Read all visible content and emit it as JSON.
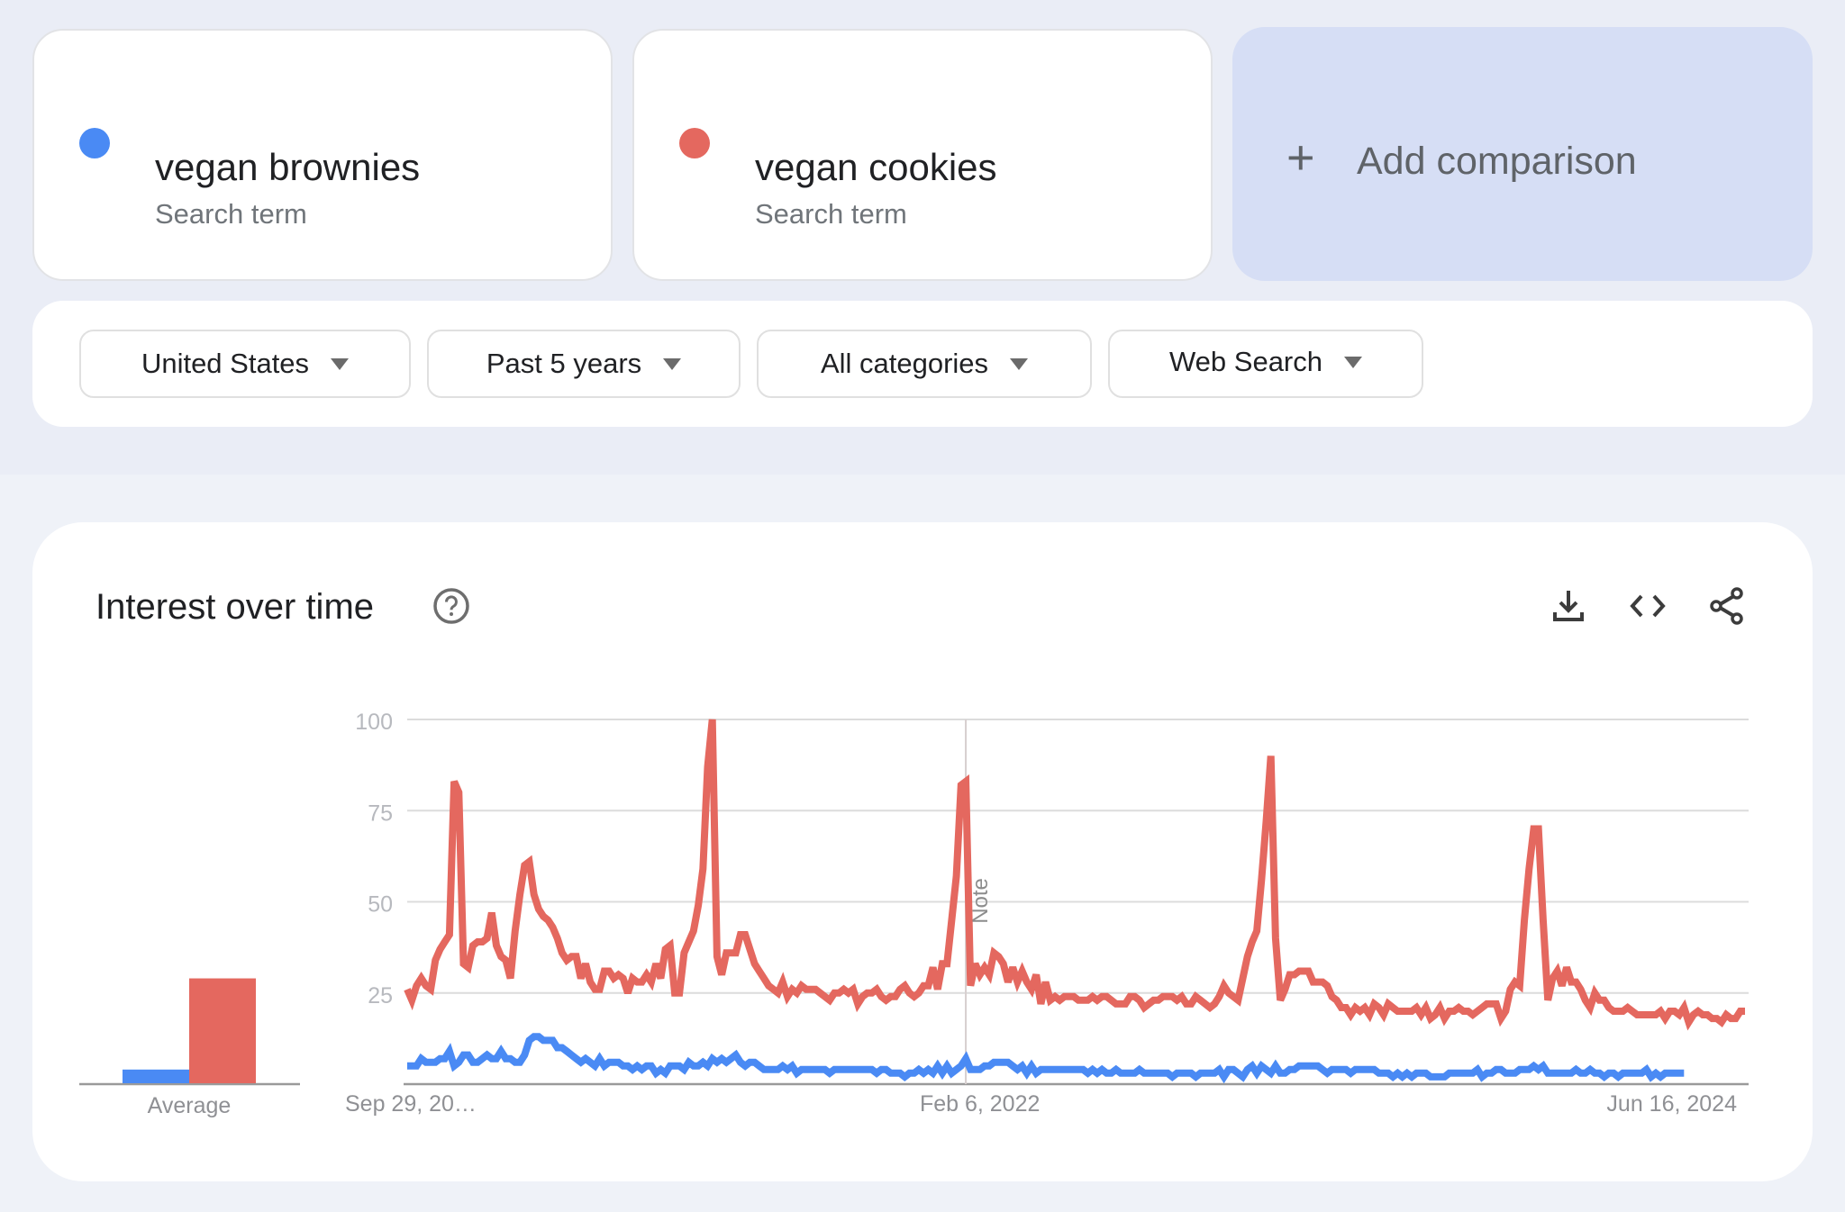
{
  "terms": [
    {
      "name": "vegan brownies",
      "subtitle": "Search term",
      "color": "#4a8af4"
    },
    {
      "name": "vegan cookies",
      "subtitle": "Search term",
      "color": "#e4685f"
    }
  ],
  "add_comparison": {
    "icon": "plus-icon",
    "label": "Add comparison"
  },
  "filters": [
    {
      "label": "United States"
    },
    {
      "label": "Past 5 years"
    },
    {
      "label": "All categories"
    },
    {
      "label": "Web Search"
    }
  ],
  "panel": {
    "title": "Interest over time",
    "help_icon": "help-circle-icon",
    "actions": [
      "download-icon",
      "embed-code-icon",
      "share-icon"
    ]
  },
  "chart_data": {
    "type": "line",
    "title": "Interest over time",
    "xlabel": "",
    "ylabel": "",
    "ylim": [
      0,
      100
    ],
    "yticks": [
      25,
      50,
      75,
      100
    ],
    "grid": true,
    "legend": "none",
    "x_tick_labels": [
      "Sep 29, 20…",
      "Feb 6, 2022",
      "Jun 16, 2024"
    ],
    "x_tick_indices": [
      0,
      122,
      246
    ],
    "annotation": {
      "label": "Note",
      "index": 119
    },
    "average_bar": {
      "label": "Average",
      "values": [
        {
          "name": "vegan brownies",
          "value": 4
        },
        {
          "name": "vegan cookies",
          "value": 29
        }
      ]
    },
    "series": [
      {
        "name": "vegan cookies",
        "color": "#e4685f",
        "values": [
          26,
          23,
          27,
          29,
          27,
          26,
          34,
          37,
          39,
          41,
          83,
          80,
          33,
          32,
          38,
          39,
          39,
          40,
          47,
          38,
          35,
          34,
          29,
          42,
          52,
          60,
          61,
          52,
          48,
          46,
          45,
          43,
          40,
          36,
          34,
          35,
          35,
          29,
          33,
          28,
          26,
          26,
          31,
          31,
          29,
          30,
          29,
          25,
          29,
          28,
          28,
          30,
          28,
          33,
          29,
          37,
          38,
          25,
          25,
          36,
          39,
          42,
          49,
          59,
          87,
          100,
          35,
          30,
          36,
          36,
          36,
          41,
          41,
          37,
          33,
          31,
          29,
          27,
          26,
          25,
          28,
          24,
          26,
          25,
          27,
          26,
          26,
          26,
          25,
          24,
          23,
          25,
          25,
          26,
          25,
          26,
          22,
          24,
          25,
          25,
          26,
          24,
          23,
          24,
          24,
          26,
          27,
          25,
          24,
          25,
          27,
          27,
          32,
          26,
          33,
          33,
          45,
          57,
          82,
          83,
          27,
          33,
          30,
          32,
          30,
          36,
          35,
          33,
          28,
          32,
          28,
          31,
          28,
          26,
          30,
          22,
          28,
          23,
          24,
          23,
          24,
          24,
          24,
          23,
          23,
          23,
          24,
          23,
          24,
          24,
          23,
          22,
          22,
          22,
          24,
          24,
          23,
          21,
          22,
          23,
          23,
          24,
          24,
          24,
          23,
          24,
          22,
          22,
          24,
          23,
          22,
          21,
          22,
          24,
          27,
          25,
          24,
          23,
          29,
          35,
          39,
          42,
          56,
          72,
          90,
          40,
          23,
          26,
          30,
          30,
          31,
          31,
          31,
          28,
          28,
          28,
          27,
          24,
          23,
          21,
          21,
          19,
          21,
          20,
          21,
          19,
          22,
          21,
          19,
          22,
          21,
          20,
          20,
          20,
          20,
          21,
          19,
          21,
          18,
          19,
          21,
          18,
          20,
          20,
          21,
          20,
          20,
          19,
          20,
          21,
          22,
          22,
          22,
          18,
          20,
          26,
          28,
          27,
          45,
          59,
          70,
          70,
          45,
          23,
          29,
          31,
          27,
          32,
          28,
          28,
          26,
          23,
          21,
          25,
          23,
          23,
          21,
          20,
          20,
          20,
          21,
          20,
          19,
          19,
          19,
          19,
          19,
          20,
          18,
          20,
          20,
          19,
          21,
          17,
          19,
          20,
          19,
          19,
          18,
          18,
          17,
          19,
          18,
          18,
          20,
          20
        ]
      },
      {
        "name": "vegan brownies",
        "color": "#4a8af4",
        "values": [
          5,
          5,
          5,
          7,
          6,
          6,
          6,
          7,
          7,
          9,
          5,
          6,
          8,
          8,
          6,
          6,
          7,
          8,
          7,
          7,
          9,
          7,
          7,
          6,
          6,
          8,
          12,
          13,
          13,
          12,
          12,
          12,
          10,
          10,
          9,
          8,
          7,
          6,
          7,
          6,
          5,
          7,
          5,
          6,
          6,
          6,
          5,
          5,
          4,
          5,
          4,
          5,
          5,
          3,
          4,
          3,
          5,
          5,
          5,
          4,
          6,
          5,
          5,
          6,
          5,
          7,
          6,
          7,
          6,
          7,
          8,
          6,
          5,
          6,
          6,
          5,
          4,
          4,
          4,
          4,
          5,
          4,
          5,
          3,
          4,
          4,
          4,
          4,
          4,
          4,
          3,
          4,
          4,
          4,
          4,
          4,
          4,
          4,
          4,
          4,
          3,
          4,
          4,
          3,
          3,
          3,
          2,
          3,
          3,
          4,
          3,
          4,
          3,
          5,
          3,
          5,
          3,
          4,
          5,
          7,
          4,
          4,
          4,
          5,
          5,
          6,
          6,
          6,
          6,
          5,
          4,
          5,
          3,
          5,
          3,
          4,
          4,
          4,
          4,
          4,
          4,
          4,
          4,
          4,
          4,
          3,
          4,
          3,
          4,
          3,
          3,
          4,
          3,
          3,
          3,
          3,
          4,
          3,
          3,
          3,
          3,
          3,
          3,
          2,
          3,
          3,
          3,
          3,
          2,
          3,
          3,
          3,
          3,
          4,
          2,
          4,
          4,
          3,
          2,
          4,
          5,
          3,
          5,
          4,
          3,
          5,
          3,
          3,
          4,
          4,
          5,
          5,
          5,
          5,
          5,
          4,
          3,
          4,
          4,
          4,
          4,
          3,
          4,
          4,
          4,
          4,
          4,
          3,
          3,
          3,
          2,
          3,
          2,
          3,
          2,
          3,
          3,
          3,
          2,
          2,
          2,
          2,
          3,
          3,
          3,
          3,
          3,
          3,
          4,
          2,
          3,
          3,
          4,
          4,
          3,
          3,
          3,
          4,
          4,
          4,
          5,
          4,
          5,
          3,
          3,
          3,
          3,
          3,
          3,
          4,
          3,
          3,
          4,
          3,
          3,
          2,
          3,
          3,
          2,
          3,
          3,
          3,
          3,
          3,
          4,
          2,
          3,
          2,
          3,
          3,
          3,
          3,
          3
        ]
      }
    ]
  }
}
